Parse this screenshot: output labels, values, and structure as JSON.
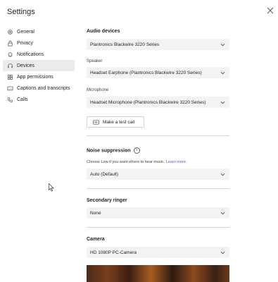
{
  "window": {
    "title": "Settings"
  },
  "sidebar": {
    "items": [
      {
        "label": "General",
        "icon": "gear-icon"
      },
      {
        "label": "Privacy",
        "icon": "lock-icon"
      },
      {
        "label": "Notifications",
        "icon": "bell-icon"
      },
      {
        "label": "Devices",
        "icon": "headset-icon",
        "active": true
      },
      {
        "label": "App permissions",
        "icon": "grid-icon"
      },
      {
        "label": "Captions and transcripts",
        "icon": "captions-icon"
      },
      {
        "label": "Calls",
        "icon": "phone-icon"
      }
    ]
  },
  "audio": {
    "heading": "Audio devices",
    "device_value": "Plantronics Blackwire 3220 Series",
    "speaker_label": "Speaker",
    "speaker_value": "Headset Earphone (Plantronics Blackwire 3220 Series)",
    "mic_label": "Microphone",
    "mic_value": "Headset Microphone (Plantronics Blackwire 3220 Series)",
    "test_call_label": "Make a test call"
  },
  "noise": {
    "heading": "Noise suppression",
    "help_text": "Choose Low if you want others to hear music.",
    "learn_more": "Learn more.",
    "value": "Auto (Default)"
  },
  "ringer": {
    "heading": "Secondary ringer",
    "value": "None"
  },
  "camera": {
    "heading": "Camera",
    "value": "HD 1080P PC-Camera"
  },
  "colors": {
    "active_bg": "#ebebeb",
    "link": "#5b5fc7",
    "select_bg": "#f3f3f3"
  }
}
